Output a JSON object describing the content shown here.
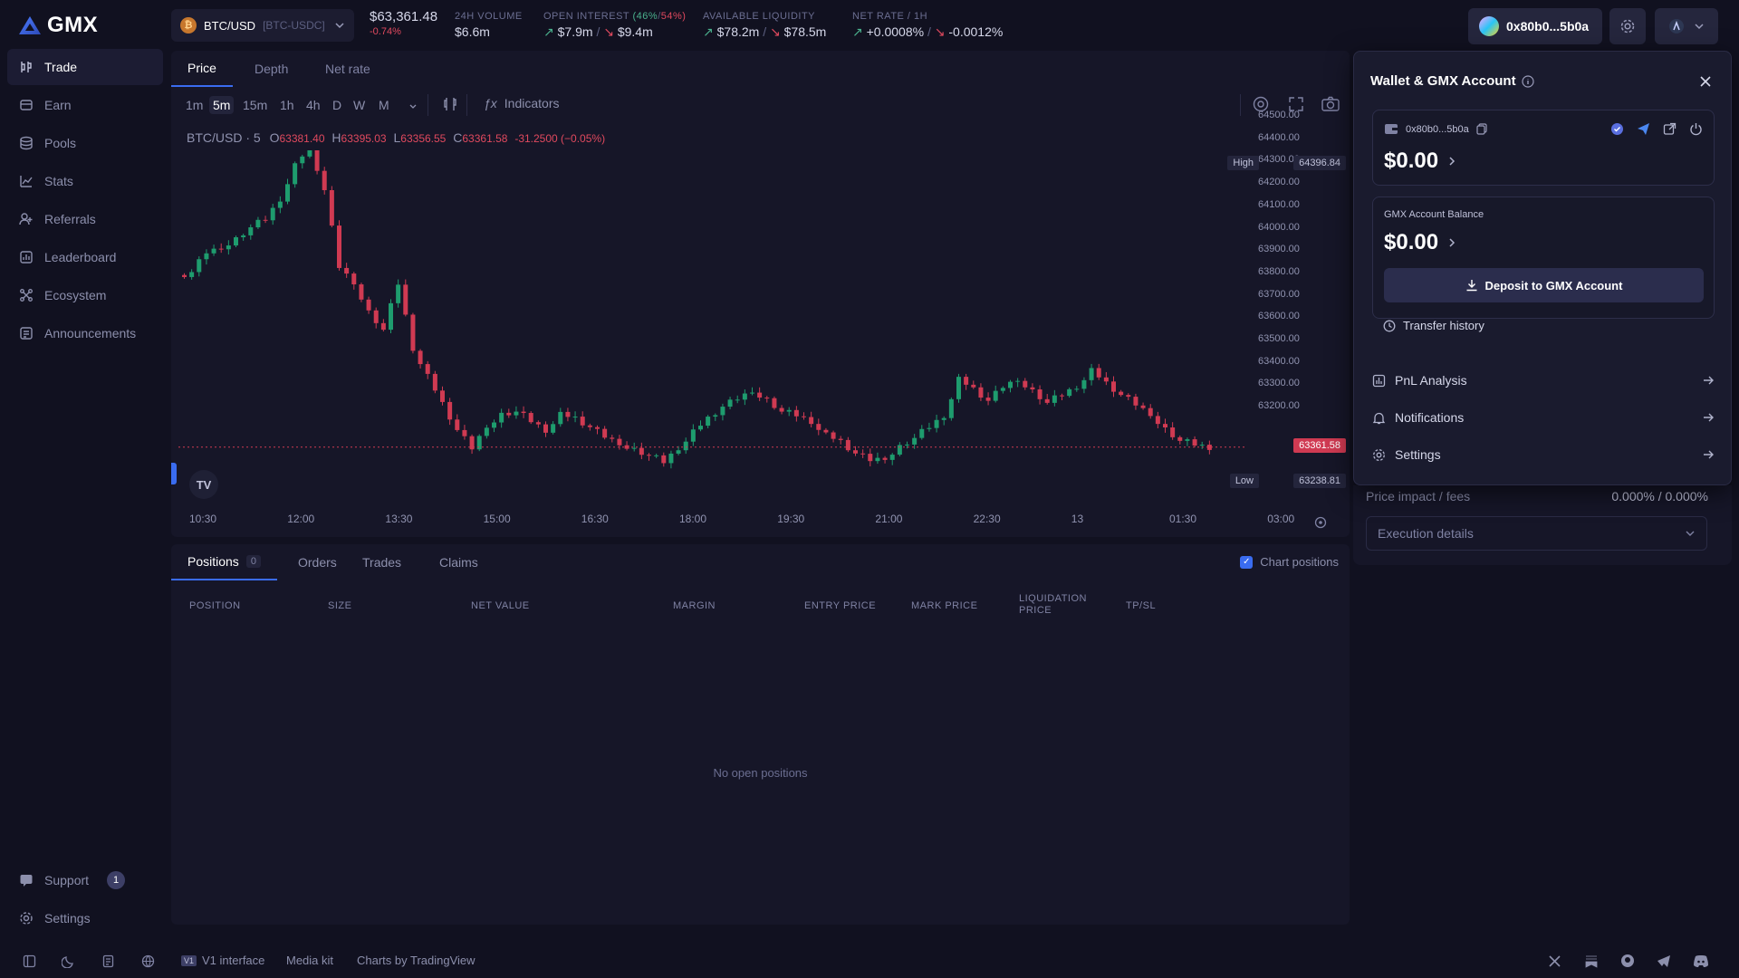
{
  "app": {
    "name": "GMX"
  },
  "sidebar": {
    "items": [
      {
        "label": "Trade",
        "icon": "trade-icon"
      },
      {
        "label": "Earn",
        "icon": "earn-icon"
      },
      {
        "label": "Pools",
        "icon": "pools-icon"
      },
      {
        "label": "Stats",
        "icon": "stats-icon"
      },
      {
        "label": "Referrals",
        "icon": "referrals-icon"
      },
      {
        "label": "Leaderboard",
        "icon": "leaderboard-icon"
      },
      {
        "label": "Ecosystem",
        "icon": "ecosystem-icon"
      },
      {
        "label": "Announcements",
        "icon": "announcements-icon"
      }
    ],
    "support": {
      "label": "Support",
      "badge": "1"
    },
    "settings": {
      "label": "Settings"
    }
  },
  "header": {
    "pair": "BTC/USD",
    "pair_sub": "[BTC-USDC]",
    "price": "$63,361.48",
    "price_change": "-0.74%",
    "volume_label": "24H VOLUME",
    "volume": "$6.6m",
    "oi_label": "OPEN INTEREST",
    "oi_long_pct": "(46%",
    "oi_sep": "/",
    "oi_short_pct": "54%)",
    "oi_long": "$7.9m",
    "oi_short": "$9.4m",
    "liq_label": "AVAILABLE LIQUIDITY",
    "liq_long": "$78.2m",
    "liq_short": "$78.5m",
    "rate_label": "NET RATE / 1H",
    "rate_long": "+0.0008%",
    "rate_short": "-0.0012%",
    "slash": "/",
    "wallet_addr": "0x80b0...5b0a"
  },
  "chart": {
    "tabs": [
      "Price",
      "Depth",
      "Net rate"
    ],
    "timeframes": [
      "1m",
      "5m",
      "15m",
      "1h",
      "4h",
      "D",
      "W",
      "M"
    ],
    "indicators_label": "Indicators",
    "symbol": "BTC/USD · 5",
    "o_label": "O",
    "o": "63381.40",
    "h_label": "H",
    "h": "63395.03",
    "l_label": "L",
    "l": "63356.55",
    "c_label": "C",
    "c": "63361.58",
    "chg": "-31.2500 (−0.05%)",
    "high_label": "High",
    "high_value": "64396.84",
    "low_label": "Low",
    "low_value": "63238.81",
    "last_value": "63361.58",
    "y_ticks": [
      "64500.00",
      "64400.00",
      "64300.00",
      "64200.00",
      "64100.00",
      "64000.00",
      "63900.00",
      "63800.00",
      "63700.00",
      "63600.00",
      "63500.00",
      "63400.00",
      "63300.00",
      "63200.00"
    ],
    "x_ticks": [
      "10:30",
      "12:00",
      "13:30",
      "15:00",
      "16:30",
      "18:00",
      "19:30",
      "21:00",
      "22:30",
      "13",
      "01:30",
      "03:00"
    ]
  },
  "chart_data": {
    "type": "candlestick",
    "ylim": [
      63200,
      64500
    ],
    "x": [
      "10:30",
      "12:00",
      "13:30",
      "15:00",
      "16:30",
      "18:00",
      "19:30",
      "21:00",
      "22:30",
      "13",
      "01:30",
      "03:00"
    ],
    "series": [
      {
        "values": [
          63960,
          64030,
          64050,
          64070,
          64110,
          64140,
          64210,
          64320,
          64390,
          64240,
          63980,
          63930,
          63820,
          63760,
          63920,
          63700,
          63600,
          63510,
          63420,
          63360,
          63440,
          63470,
          63480,
          63450,
          63420,
          63470,
          63460,
          63430,
          63400,
          63380,
          63350,
          63330,
          63310,
          63360,
          63410,
          63460,
          63500,
          63530,
          63560,
          63520,
          63480,
          63470,
          63450,
          63400,
          63380,
          63340,
          63320,
          63330,
          63360,
          63390,
          63430,
          63470,
          63590,
          63560,
          63520,
          63570,
          63600,
          63550,
          63510,
          63540,
          63570,
          63620,
          63580,
          63540,
          63510,
          63480,
          63420,
          63380,
          63370,
          63361
        ]
      }
    ],
    "high": 64396.84,
    "low": 63238.81,
    "last": 63361.58
  },
  "positions": {
    "tabs": [
      {
        "label": "Positions",
        "count": "0"
      },
      {
        "label": "Orders"
      },
      {
        "label": "Trades"
      },
      {
        "label": "Claims"
      }
    ],
    "chart_positions_label": "Chart positions",
    "columns": [
      "POSITION",
      "SIZE",
      "NET VALUE",
      "MARGIN",
      "ENTRY PRICE",
      "MARK PRICE",
      "LIQUIDATION PRICE",
      "TP/SL"
    ],
    "empty": "No open positions"
  },
  "wallet_panel": {
    "title": "Wallet & GMX Account",
    "addr": "0x80b0...5b0a",
    "wallet_balance": "$0.00",
    "gmx_label": "GMX Account Balance",
    "gmx_balance": "$0.00",
    "deposit_label": "Deposit to GMX Account",
    "transfer_label": "Transfer history",
    "pnl_label": "PnL Analysis",
    "notifications_label": "Notifications",
    "settings_label": "Settings"
  },
  "behind_panel": {
    "price_impact_label": "Price impact / fees",
    "price_impact_value": "0.000% / 0.000%",
    "exec_label": "Execution details"
  },
  "footer": {
    "v1": "V1 interface",
    "v1_badge": "V1",
    "media": "Media kit",
    "charts_by": "Charts by TradingView"
  },
  "colors": {
    "up": "#1e9c6e",
    "down": "#d03a52",
    "accent": "#3a6cf0",
    "bg": "#111120"
  }
}
